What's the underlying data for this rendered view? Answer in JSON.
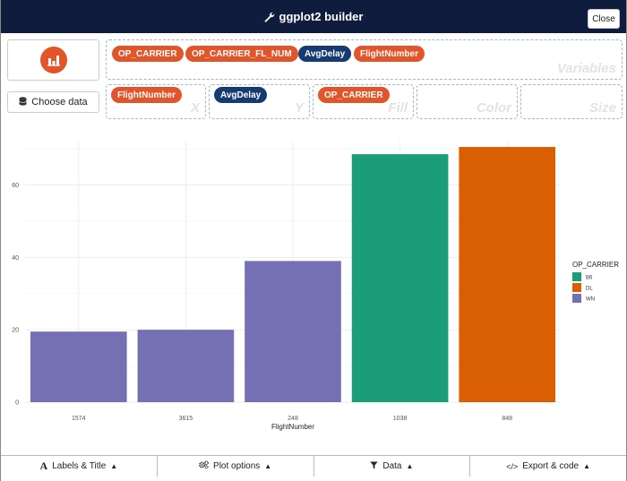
{
  "app": {
    "title": "ggplot2 builder",
    "close_label": "Close"
  },
  "sidebar": {
    "choose_data_label": "Choose data"
  },
  "zones": {
    "variables": {
      "label": "Variables",
      "pills": [
        {
          "text": "OP_CARRIER",
          "color": "#e2542a"
        },
        {
          "text": "OP_CARRIER_FL_NUM",
          "color": "#e2542a"
        },
        {
          "text": "AvgDelay",
          "color": "#163a72"
        },
        {
          "text": "FlightNumber",
          "color": "#e2542a"
        }
      ]
    },
    "x": {
      "label": "X",
      "pill": "FlightNumber"
    },
    "y": {
      "label": "Y",
      "pill": "AvgDelay"
    },
    "fill": {
      "label": "Fill",
      "pill": "OP_CARRIER"
    },
    "color": {
      "label": "Color"
    },
    "size": {
      "label": "Size"
    }
  },
  "chart_data": {
    "type": "bar",
    "categories": [
      "1574",
      "3615",
      "248",
      "1038",
      "848"
    ],
    "values": [
      19.5,
      20,
      39,
      68.5,
      70.5
    ],
    "fill_group": [
      "WN",
      "WN",
      "WN",
      "B6",
      "DL"
    ],
    "xlabel": "FlightNumber",
    "ylabel": "",
    "ylim": [
      0,
      72
    ],
    "yticks": [
      0,
      20,
      40,
      60
    ],
    "grid": true,
    "legend": {
      "title": "OP_CARRIER",
      "position": "right",
      "entries": [
        {
          "label": "B6",
          "color": "#1b9e77"
        },
        {
          "label": "DL",
          "color": "#d95f02"
        },
        {
          "label": "WN",
          "color": "#7570b3"
        }
      ]
    }
  },
  "bottom_tabs": [
    {
      "label": "Labels & Title",
      "icon": "font-icon"
    },
    {
      "label": "Plot options",
      "icon": "gears-icon"
    },
    {
      "label": "Data",
      "icon": "filter-icon"
    },
    {
      "label": "Export & code",
      "icon": "code-icon"
    }
  ],
  "colors": {
    "header": "#101c3e",
    "accent": "#e2542a",
    "pill_navy": "#163a72"
  }
}
